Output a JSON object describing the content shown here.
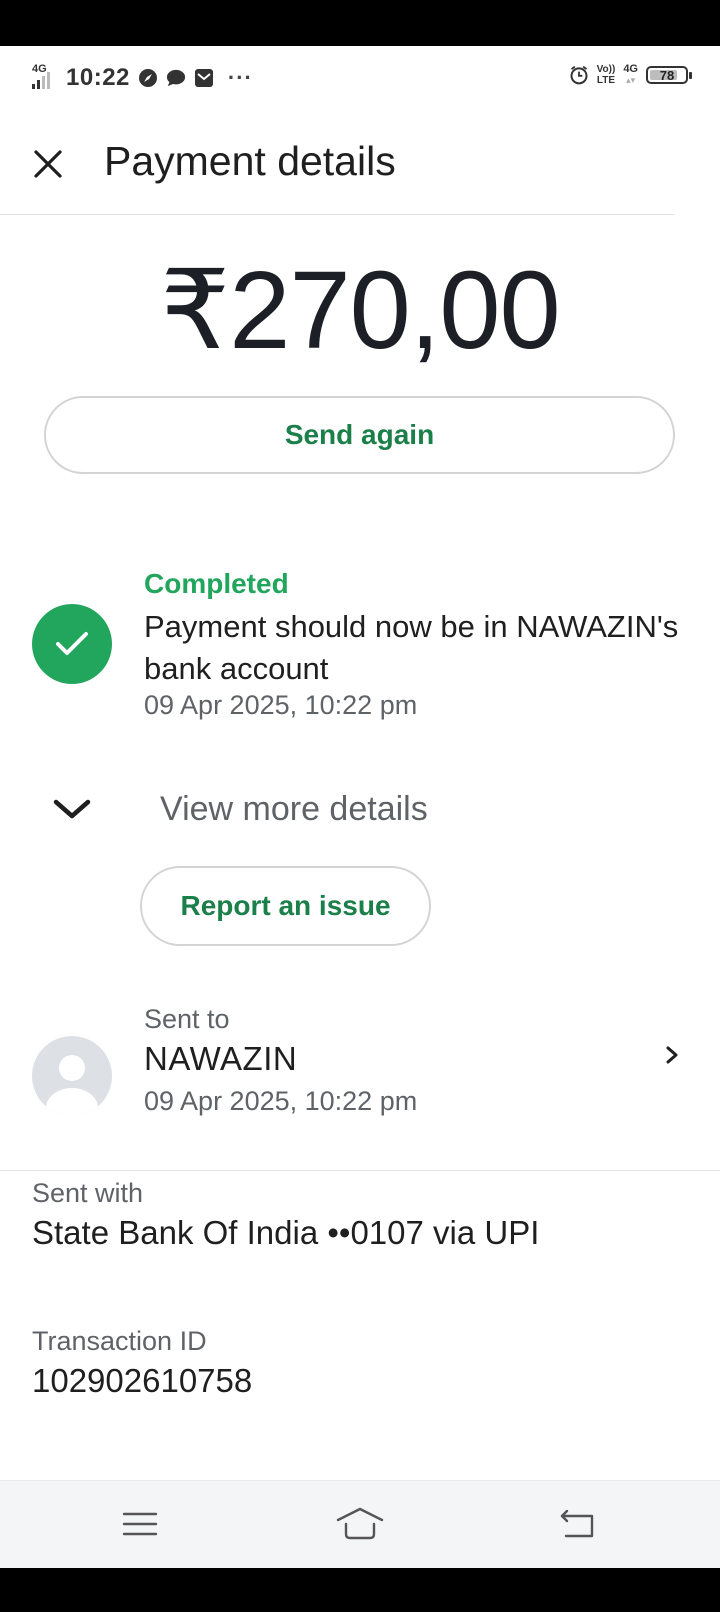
{
  "status_bar": {
    "network": "4G",
    "time": "10:22",
    "overflow_dots": "···",
    "volte_top": "Vo))",
    "volte_bottom": "LTE",
    "network_right": "4G",
    "battery_level": "78",
    "battery_fraction": 0.78
  },
  "header": {
    "title": "Payment details"
  },
  "payment": {
    "amount": "₹270,00",
    "send_again_label": "Send again"
  },
  "status": {
    "label": "Completed",
    "message": "Payment should now be in NAWAZIN's bank account",
    "timestamp": "09 Apr 2025, 10:22 pm"
  },
  "details": {
    "expand_label": "View more details",
    "report_label": "Report an issue"
  },
  "recipient": {
    "label": "Sent to",
    "name": "NAWAZIN",
    "timestamp": "09 Apr 2025, 10:22 pm"
  },
  "sent_with": {
    "label": "Sent with",
    "value": "State Bank Of India ••0107 via UPI"
  },
  "transaction": {
    "label": "Transaction ID",
    "value": "102902610758"
  },
  "colors": {
    "accent_green": "#1b7f4a",
    "success_green": "#22a55c"
  }
}
